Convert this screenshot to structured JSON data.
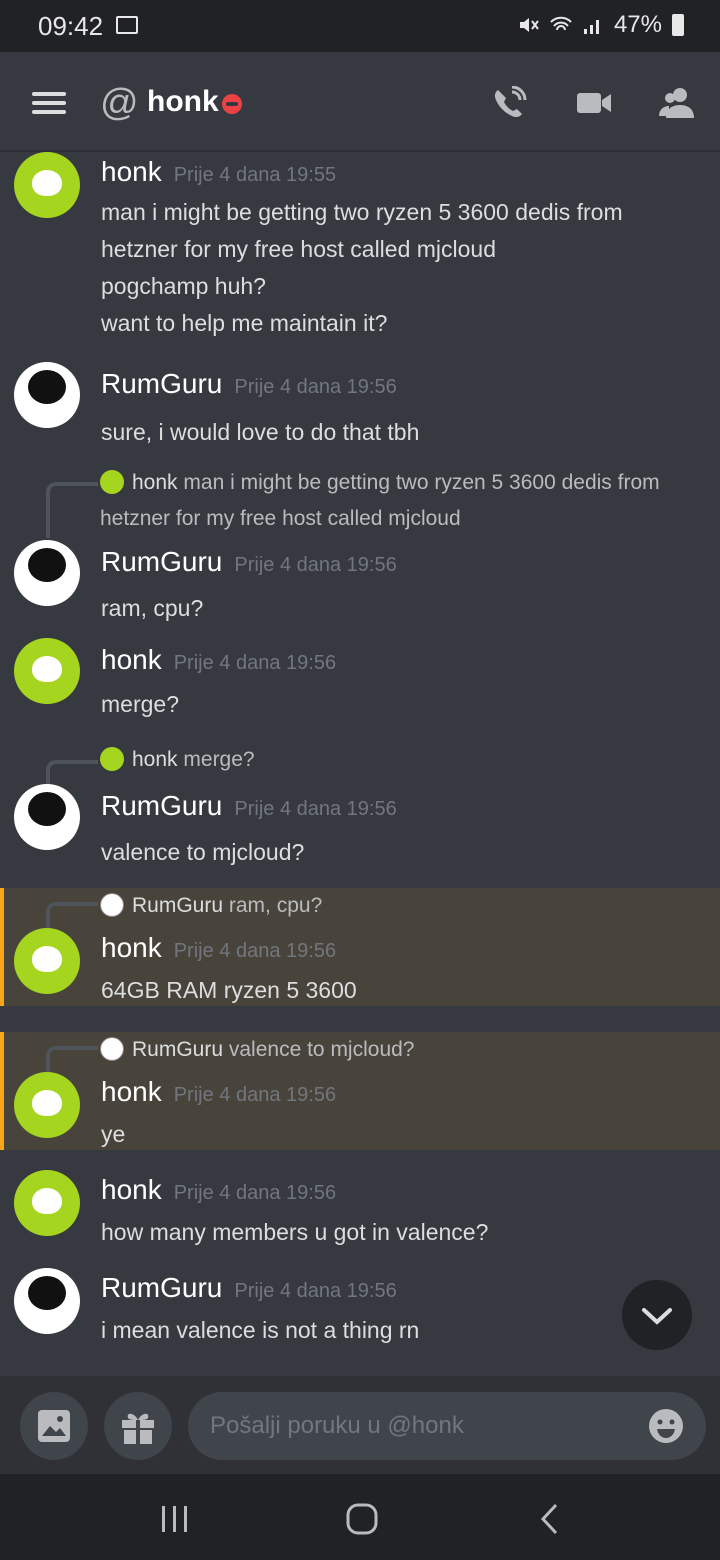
{
  "statusbar": {
    "time": "09:42",
    "battery": "47%"
  },
  "header": {
    "at": "@",
    "title": "honk",
    "icons": [
      "call-icon",
      "video-icon",
      "members-icon"
    ]
  },
  "messages": [
    {
      "author": "honk",
      "ts": "Prije 4 dana 19:55",
      "lines": [
        "man i might be getting two ryzen 5 3600 dedis from",
        "hetzner for my free host called mjcloud",
        "pogchamp huh?",
        "want to help me maintain it?"
      ]
    },
    {
      "author": "RumGuru",
      "ts": "Prije 4 dana 19:56",
      "lines": [
        "sure, i would love to do that tbh"
      ]
    },
    {
      "reply": {
        "author": "honk",
        "text": "man i might be getting two ryzen 5 3600 dedis from",
        "text2": "hetzner for my free host called mjcloud"
      },
      "author": "RumGuru",
      "ts": "Prije 4 dana 19:56",
      "lines": [
        "ram, cpu?"
      ]
    },
    {
      "author": "honk",
      "ts": "Prije 4 dana 19:56",
      "lines": [
        "merge?"
      ]
    },
    {
      "reply": {
        "author": "honk",
        "text": "merge?"
      },
      "author": "RumGuru",
      "ts": "Prije 4 dana 19:56",
      "lines": [
        "valence to mjcloud?"
      ]
    },
    {
      "reply": {
        "author": "RumGuru",
        "text": "ram, cpu?"
      },
      "author": "honk",
      "ts": "Prije 4 dana 19:56",
      "lines": [
        "64GB RAM ryzen 5 3600"
      ]
    },
    {
      "reply": {
        "author": "RumGuru",
        "text": "valence to mjcloud?"
      },
      "author": "honk",
      "ts": "Prije 4 dana 19:56",
      "lines": [
        "ye"
      ]
    },
    {
      "author": "honk",
      "ts": "Prije 4 dana 19:56",
      "lines": [
        "how many members u got in valence?"
      ]
    },
    {
      "author": "RumGuru",
      "ts": "Prije 4 dana 19:56",
      "lines": [
        "i mean valence is not a thing rn"
      ]
    }
  ],
  "composer": {
    "placeholder": "Pošalji poruku u @honk"
  }
}
